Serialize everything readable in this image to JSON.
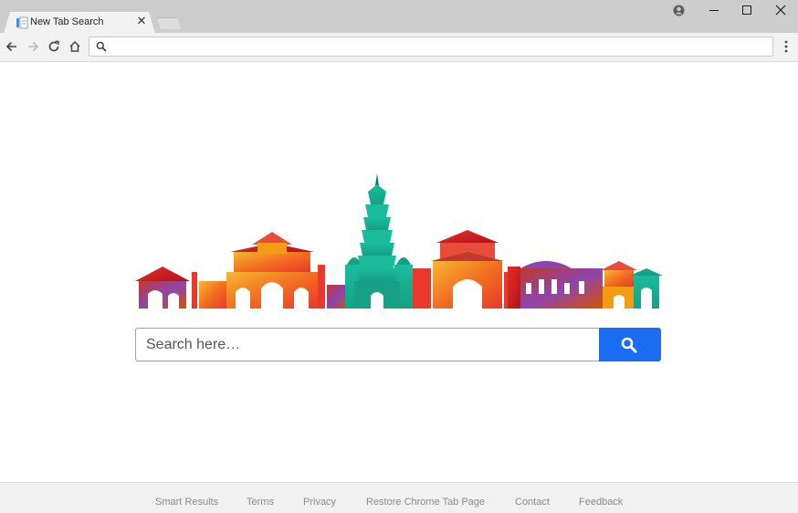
{
  "browser": {
    "tab": {
      "title": "New Tab Search",
      "close_icon": "close-icon",
      "favicon": "page-favicon-icon"
    },
    "window_controls": [
      "profile-icon",
      "minimize-icon",
      "maximize-icon",
      "close-window-icon"
    ],
    "toolbar": {
      "icons": [
        "back-icon",
        "forward-icon",
        "reload-icon",
        "home-icon"
      ],
      "omnibox": {
        "value": "",
        "icon": "search-icon"
      },
      "menu_icon": "menu-icon"
    }
  },
  "main": {
    "hero_image": "city-skyline-illustration",
    "search": {
      "placeholder": "Search here…",
      "button_icon": "search-icon",
      "button_color": "#1a6df2"
    }
  },
  "footer": {
    "links": [
      "Smart Results",
      "Terms",
      "Privacy",
      "Restore Chrome Tab Page",
      "Contact",
      "Feedback"
    ]
  }
}
